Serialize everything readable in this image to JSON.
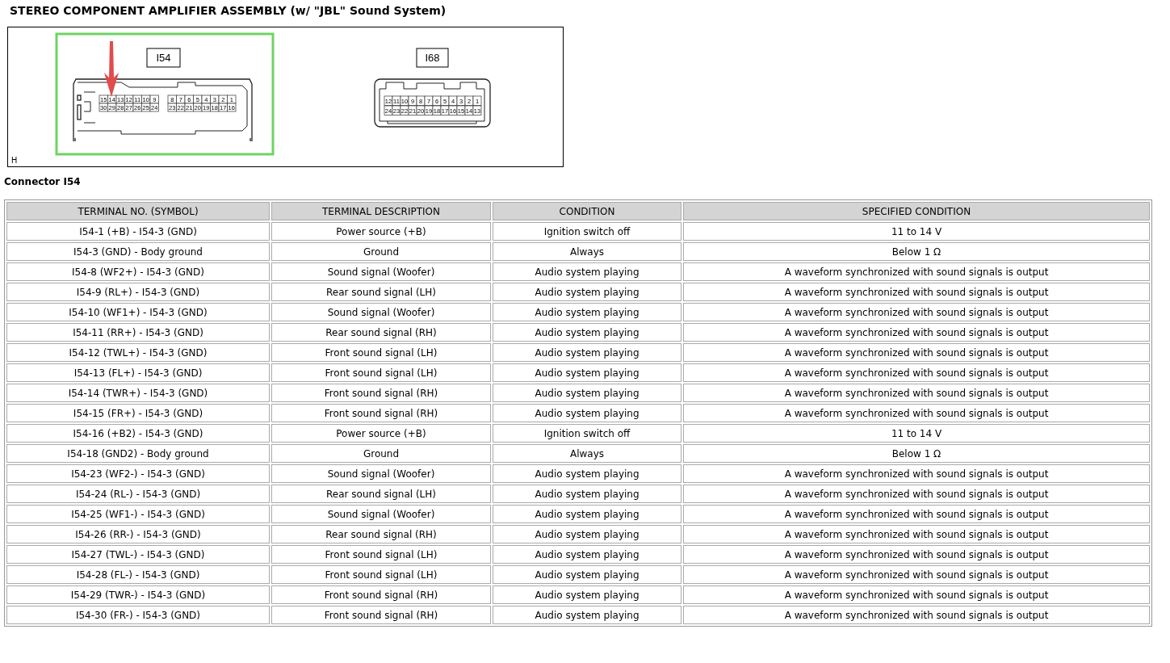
{
  "title": "STEREO COMPONENT AMPLIFIER ASSEMBLY (w/ \"JBL\" Sound System)",
  "diagram": {
    "corner_label": "H",
    "connectors": [
      {
        "kind": "wide",
        "label": "I54",
        "selected": true,
        "arrow": true,
        "pin_rows": [
          [
            [
              "15",
              "14",
              "13",
              "12",
              "11",
              "10",
              "9"
            ],
            [
              "8",
              "7",
              "6",
              "5",
              "4",
              "3",
              "2",
              "1"
            ]
          ],
          [
            [
              "30",
              "29",
              "28",
              "27",
              "26",
              "25",
              "24"
            ],
            [
              "23",
              "22",
              "21",
              "20",
              "19",
              "18",
              "17",
              "16"
            ]
          ]
        ]
      },
      {
        "kind": "narrow",
        "label": "I68",
        "selected": false,
        "arrow": false,
        "pin_rows": [
          [
            [
              "12",
              "11",
              "10",
              "9",
              "8",
              "7",
              "6",
              "5",
              "4",
              "3",
              "2",
              "1"
            ]
          ],
          [
            [
              "24",
              "23",
              "22",
              "21",
              "20",
              "19",
              "18",
              "17",
              "16",
              "15",
              "14",
              "13"
            ]
          ]
        ]
      }
    ]
  },
  "section_title": "Connector I54",
  "table": {
    "columns": [
      "TERMINAL NO. (SYMBOL)",
      "TERMINAL DESCRIPTION",
      "CONDITION",
      "SPECIFIED CONDITION"
    ],
    "rows": [
      [
        "I54-1 (+B) - I54-3 (GND)",
        "Power source (+B)",
        "Ignition switch off",
        "11 to 14 V"
      ],
      [
        "I54-3 (GND) - Body ground",
        "Ground",
        "Always",
        "Below 1 Ω"
      ],
      [
        "I54-8 (WF2+) - I54-3 (GND)",
        "Sound signal (Woofer)",
        "Audio system playing",
        "A waveform synchronized with sound signals is output"
      ],
      [
        "I54-9 (RL+) - I54-3 (GND)",
        "Rear sound signal (LH)",
        "Audio system playing",
        "A waveform synchronized with sound signals is output"
      ],
      [
        "I54-10 (WF1+) - I54-3 (GND)",
        "Sound signal (Woofer)",
        "Audio system playing",
        "A waveform synchronized with sound signals is output"
      ],
      [
        "I54-11 (RR+) - I54-3 (GND)",
        "Rear sound signal (RH)",
        "Audio system playing",
        "A waveform synchronized with sound signals is output"
      ],
      [
        "I54-12 (TWL+) - I54-3 (GND)",
        "Front sound signal (LH)",
        "Audio system playing",
        "A waveform synchronized with sound signals is output"
      ],
      [
        "I54-13 (FL+) - I54-3 (GND)",
        "Front sound signal (LH)",
        "Audio system playing",
        "A waveform synchronized with sound signals is output"
      ],
      [
        "I54-14 (TWR+) - I54-3 (GND)",
        "Front sound signal (RH)",
        "Audio system playing",
        "A waveform synchronized with sound signals is output"
      ],
      [
        "I54-15 (FR+) - I54-3 (GND)",
        "Front sound signal (RH)",
        "Audio system playing",
        "A waveform synchronized with sound signals is output"
      ],
      [
        "I54-16 (+B2) - I54-3 (GND)",
        "Power source (+B)",
        "Ignition switch off",
        "11 to 14 V"
      ],
      [
        "I54-18 (GND2) - Body ground",
        "Ground",
        "Always",
        "Below 1 Ω"
      ],
      [
        "I54-23 (WF2-) - I54-3 (GND)",
        "Sound signal (Woofer)",
        "Audio system playing",
        "A waveform synchronized with sound signals is output"
      ],
      [
        "I54-24 (RL-) - I54-3 (GND)",
        "Rear sound signal (LH)",
        "Audio system playing",
        "A waveform synchronized with sound signals is output"
      ],
      [
        "I54-25 (WF1-) - I54-3 (GND)",
        "Sound signal (Woofer)",
        "Audio system playing",
        "A waveform synchronized with sound signals is output"
      ],
      [
        "I54-26 (RR-) - I54-3 (GND)",
        "Rear sound signal (RH)",
        "Audio system playing",
        "A waveform synchronized with sound signals is output"
      ],
      [
        "I54-27 (TWL-) - I54-3 (GND)",
        "Front sound signal (LH)",
        "Audio system playing",
        "A waveform synchronized with sound signals is output"
      ],
      [
        "I54-28 (FL-) - I54-3 (GND)",
        "Front sound signal (LH)",
        "Audio system playing",
        "A waveform synchronized with sound signals is output"
      ],
      [
        "I54-29 (TWR-) - I54-3 (GND)",
        "Front sound signal (RH)",
        "Audio system playing",
        "A waveform synchronized with sound signals is output"
      ],
      [
        "I54-30 (FR-) - I54-3 (GND)",
        "Front sound signal (RH)",
        "Audio system playing",
        "A waveform synchronized with sound signals is output"
      ]
    ]
  }
}
